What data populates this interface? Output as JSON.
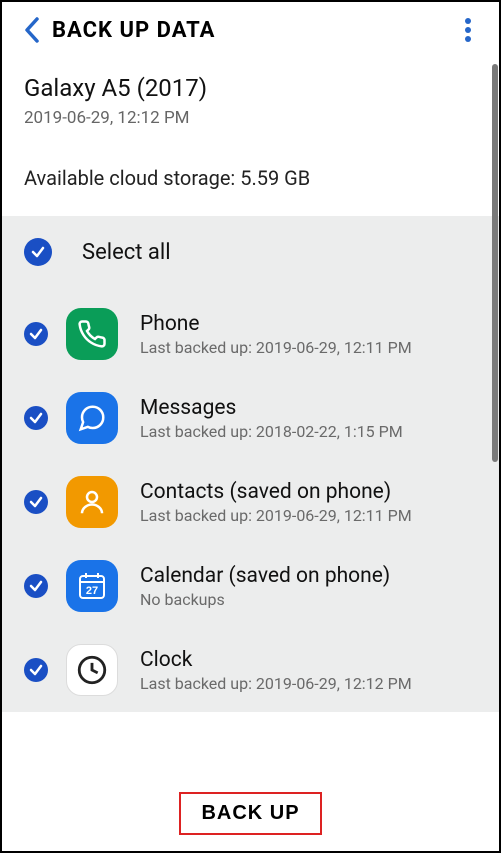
{
  "header": {
    "title": "BACK UP DATA"
  },
  "device": {
    "name": "Galaxy A5 (2017)",
    "timestamp": "2019-06-29, 12:12 PM"
  },
  "storage": {
    "label": "Available cloud storage: 5.59 GB"
  },
  "select_all": {
    "label": "Select all"
  },
  "items": [
    {
      "name": "Phone",
      "sub": "Last backed up: 2019-06-29, 12:11 PM",
      "icon": "phone-icon"
    },
    {
      "name": "Messages",
      "sub": "Last backed up: 2018-02-22, 1:15 PM",
      "icon": "messages-icon"
    },
    {
      "name": "Contacts (saved on phone)",
      "sub": "Last backed up: 2019-06-29, 12:11 PM",
      "icon": "contacts-icon"
    },
    {
      "name": "Calendar (saved on phone)",
      "sub": "No backups",
      "icon": "calendar-icon"
    },
    {
      "name": "Clock",
      "sub": "Last backed up: 2019-06-29, 12:12 PM",
      "icon": "clock-icon"
    }
  ],
  "footer": {
    "backup_label": "BACK UP"
  },
  "calendar_day": "27"
}
